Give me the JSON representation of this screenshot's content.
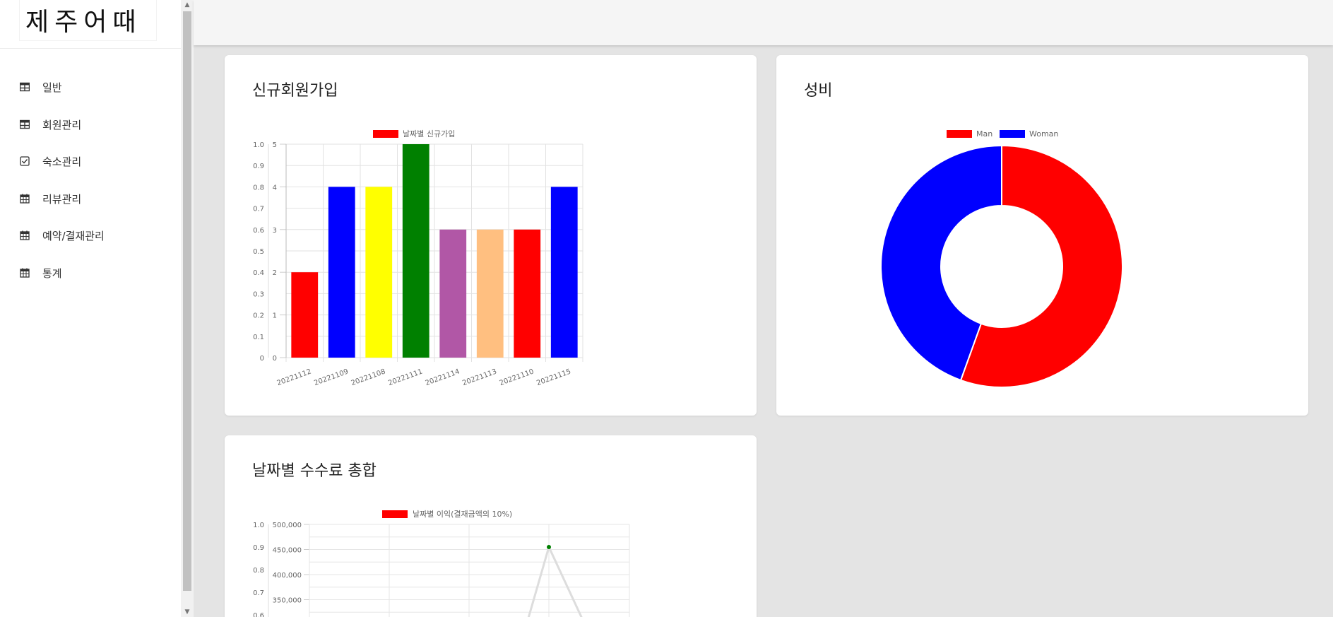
{
  "logo": {
    "text": "제주어때"
  },
  "sidebar": {
    "items": [
      {
        "label": "일반",
        "icon": "table-icon"
      },
      {
        "label": "회원관리",
        "icon": "table-icon"
      },
      {
        "label": "숙소관리",
        "icon": "checkbox-icon"
      },
      {
        "label": "리뷰관리",
        "icon": "calendar-icon"
      },
      {
        "label": "예약/결재관리",
        "icon": "calendar-icon"
      },
      {
        "label": "통계",
        "icon": "calendar-icon"
      }
    ]
  },
  "cards": {
    "signup": {
      "title": "신규회원가입"
    },
    "gender": {
      "title": "성비"
    },
    "fees": {
      "title": "날짜별 수수료 총합"
    }
  },
  "chart_data": [
    {
      "type": "bar",
      "legend": [
        "날짜별 신규가입"
      ],
      "categories": [
        "20221112",
        "20221109",
        "20221108",
        "20221111",
        "20221114",
        "20221113",
        "20221110",
        "20221115"
      ],
      "values": [
        2,
        4,
        4,
        5,
        3,
        3,
        3,
        4
      ],
      "colors": [
        "#ff0000",
        "#0000ff",
        "#ffff00",
        "#008000",
        "#b157a6",
        "#ffbf80",
        "#ff0000",
        "#0000ff"
      ],
      "ylim": [
        0,
        5
      ],
      "y_ticks": [
        "0",
        "1",
        "2",
        "3",
        "4",
        "5"
      ],
      "y2_ticks": [
        "0",
        "0.1",
        "0.2",
        "0.3",
        "0.4",
        "0.5",
        "0.6",
        "0.7",
        "0.8",
        "0.9",
        "1.0"
      ],
      "grid": true,
      "legend_position": "top"
    },
    {
      "type": "pie",
      "legend": [
        "Man",
        "Woman"
      ],
      "categories": [
        "Man",
        "Woman"
      ],
      "values": [
        0.555,
        0.445
      ],
      "colors": [
        "#ff0000",
        "#0000ff"
      ],
      "legend_position": "top"
    },
    {
      "type": "line",
      "legend": [
        "날짜별 이익(결재금액의 10%)"
      ],
      "y_ticks": [
        "500,000",
        "450,000",
        "400,000",
        "350,000"
      ],
      "y2_ticks": [
        "1.0",
        "0.9",
        "0.8",
        "0.7",
        "0.6"
      ],
      "point_values": [
        455000
      ],
      "point_color": "#008000",
      "line_color": "#dddddd",
      "grid": true,
      "legend_position": "top"
    }
  ]
}
